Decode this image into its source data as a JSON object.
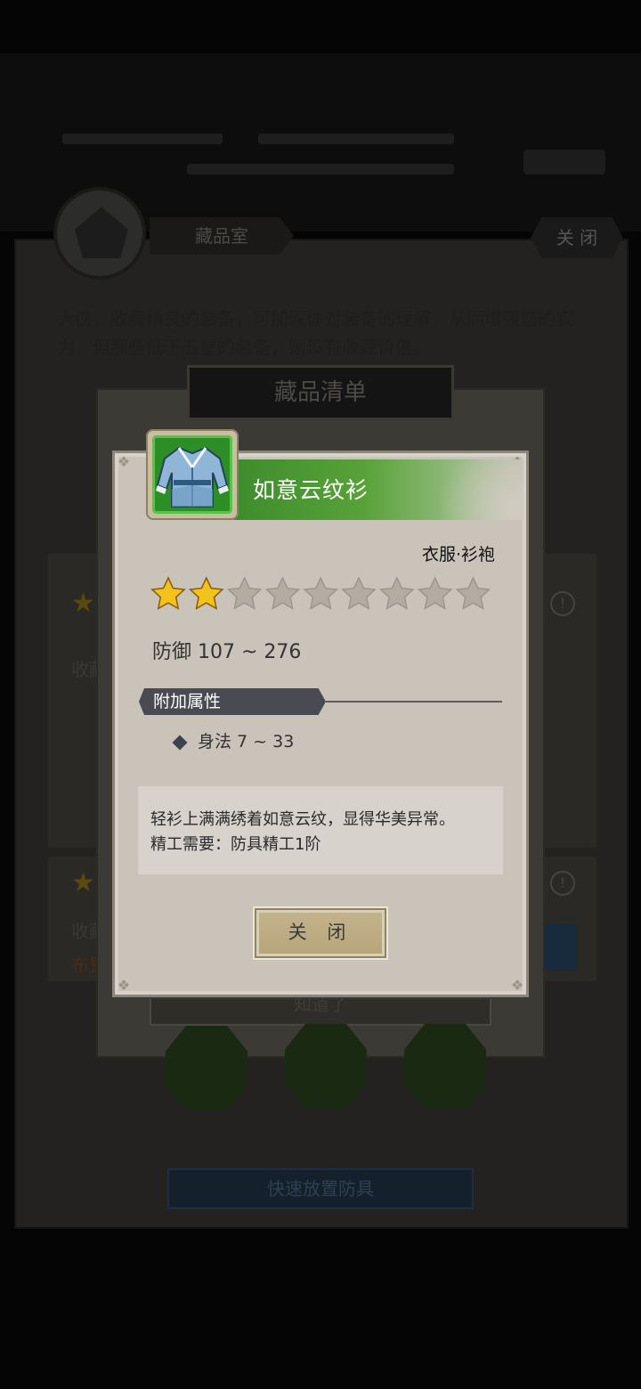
{
  "background": {
    "panel_title": "藏品室",
    "close_label": "关 闭",
    "description": "大侠，收藏精良的装备，可加深你对装备的理解，从而增强您的实力，但那些低于五星的装备，则没有收藏价值。",
    "list_title": "藏品清单",
    "got_it_label": "知道了",
    "quick_place_label": "快速放置防具",
    "row_label_1": "收藏",
    "row_label_2": "收藏",
    "row_label_3": "布置"
  },
  "item": {
    "name": "如意云纹衫",
    "category": "衣服·衫袍",
    "stars_total": 9,
    "stars_filled": 2,
    "stat_line": "防御  107 ~ 276",
    "attr_header": "附加属性",
    "attr_line": "身法  7 ~ 33",
    "desc_line_1": "轻衫上满满绣着如意云纹，显得华美异常。",
    "desc_line_2": "精工需要：防具精工1阶",
    "close_label": "关 闭",
    "icon": "robe-icon"
  },
  "colors": {
    "rarity_green": "#4e9a33",
    "star_gold": "#f2c31c",
    "star_empty": "#b3aca1"
  }
}
